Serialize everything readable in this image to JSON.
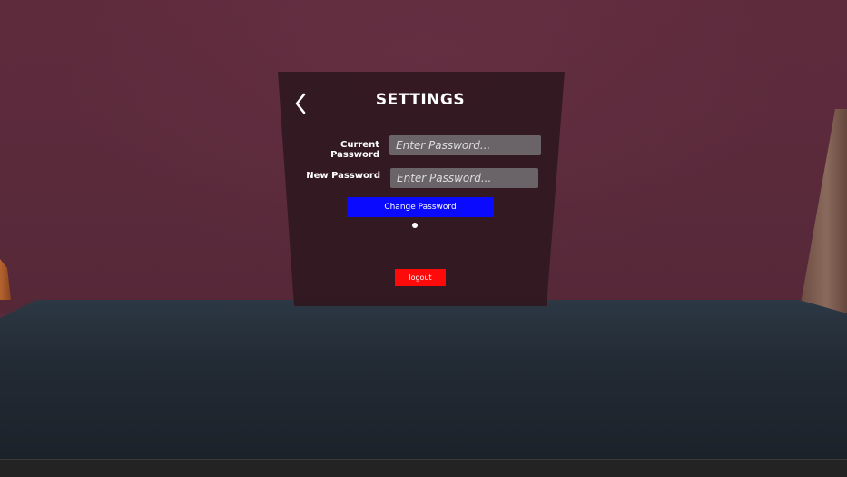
{
  "settings": {
    "title": "SETTINGS",
    "back_icon": "chevron-left-icon",
    "current_password": {
      "label": "Current Password",
      "placeholder": "Enter Password..."
    },
    "new_password": {
      "label": "New Password",
      "placeholder": "Enter Password..."
    },
    "change_password_label": "Change Password",
    "logout_label": "logout"
  },
  "colors": {
    "change_button": "#0a0aff",
    "logout_button": "#ff0a0a",
    "panel": "#301820",
    "wall": "#5a2a3b",
    "floor": "#222a34"
  }
}
